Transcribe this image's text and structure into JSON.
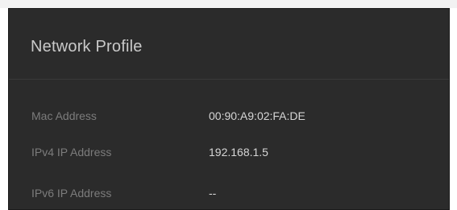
{
  "panel": {
    "title": "Network Profile",
    "rows": [
      {
        "label": "Mac Address",
        "value": "00:90:A9:02:FA:DE"
      },
      {
        "label": "IPv4 IP Address",
        "value": "192.168.1.5"
      },
      {
        "label": "IPv6 IP Address",
        "value": "--"
      }
    ]
  }
}
